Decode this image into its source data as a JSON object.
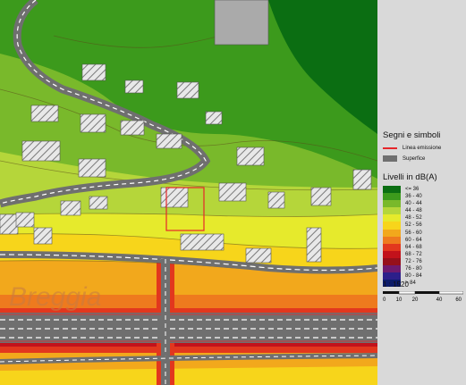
{
  "map": {
    "place_label": "Breggia",
    "noise_bands": [
      {
        "range": "<= 36",
        "color": "#0b6e12"
      },
      {
        "range": "36 - 40",
        "color": "#3c9a1c"
      },
      {
        "range": "40 - 44",
        "color": "#79b92b"
      },
      {
        "range": "44 - 48",
        "color": "#b5d63a"
      },
      {
        "range": "48 - 52",
        "color": "#e6ea2c"
      },
      {
        "range": "52 - 56",
        "color": "#f7d51b"
      },
      {
        "range": "56 - 60",
        "color": "#f2a81c"
      },
      {
        "range": "60 - 64",
        "color": "#ee7a1e"
      },
      {
        "range": "64 - 68",
        "color": "#e2371e"
      },
      {
        "range": "68 - 72",
        "color": "#c2121b"
      },
      {
        "range": "72 - 76",
        "color": "#96101b"
      },
      {
        "range": "76 - 80",
        "color": "#6e1a6e"
      },
      {
        "range": "80 - 84",
        "color": "#2c1f8a"
      },
      {
        "range": "> 84",
        "color": "#0d1c6a"
      }
    ]
  },
  "legend": {
    "symbols_title": "Segni e simboli",
    "symbols": [
      {
        "label": "Linea emissione",
        "icon": "red-line"
      },
      {
        "label": "Superfice",
        "icon": "grey-box"
      }
    ],
    "levels_title": "Livelli in dB(A)",
    "levels": [
      {
        "label": "<= 36",
        "color": "#0b6e12"
      },
      {
        "label": "36 - 40",
        "color": "#3c9a1c"
      },
      {
        "label": "40 - 44",
        "color": "#79b92b"
      },
      {
        "label": "44 - 48",
        "color": "#b5d63a"
      },
      {
        "label": "48 - 52",
        "color": "#e6ea2c"
      },
      {
        "label": "52 - 56",
        "color": "#f7d51b"
      },
      {
        "label": "56 - 60",
        "color": "#f2a81c"
      },
      {
        "label": "60 - 64",
        "color": "#ee7a1e"
      },
      {
        "label": "64 - 68",
        "color": "#e2371e"
      },
      {
        "label": "68 - 72",
        "color": "#c2121b"
      },
      {
        "label": "72 - 76",
        "color": "#96101b"
      },
      {
        "label": "76 - 80",
        "color": "#6e1a6e"
      },
      {
        "label": "80 - 84",
        "color": "#2c1f8a"
      },
      {
        "label": "> 84",
        "color": "#0d1c6a"
      }
    ],
    "scale_text": "1 : 1520",
    "scale_ticks": [
      "0",
      "10",
      "20",
      "40",
      "60"
    ]
  }
}
